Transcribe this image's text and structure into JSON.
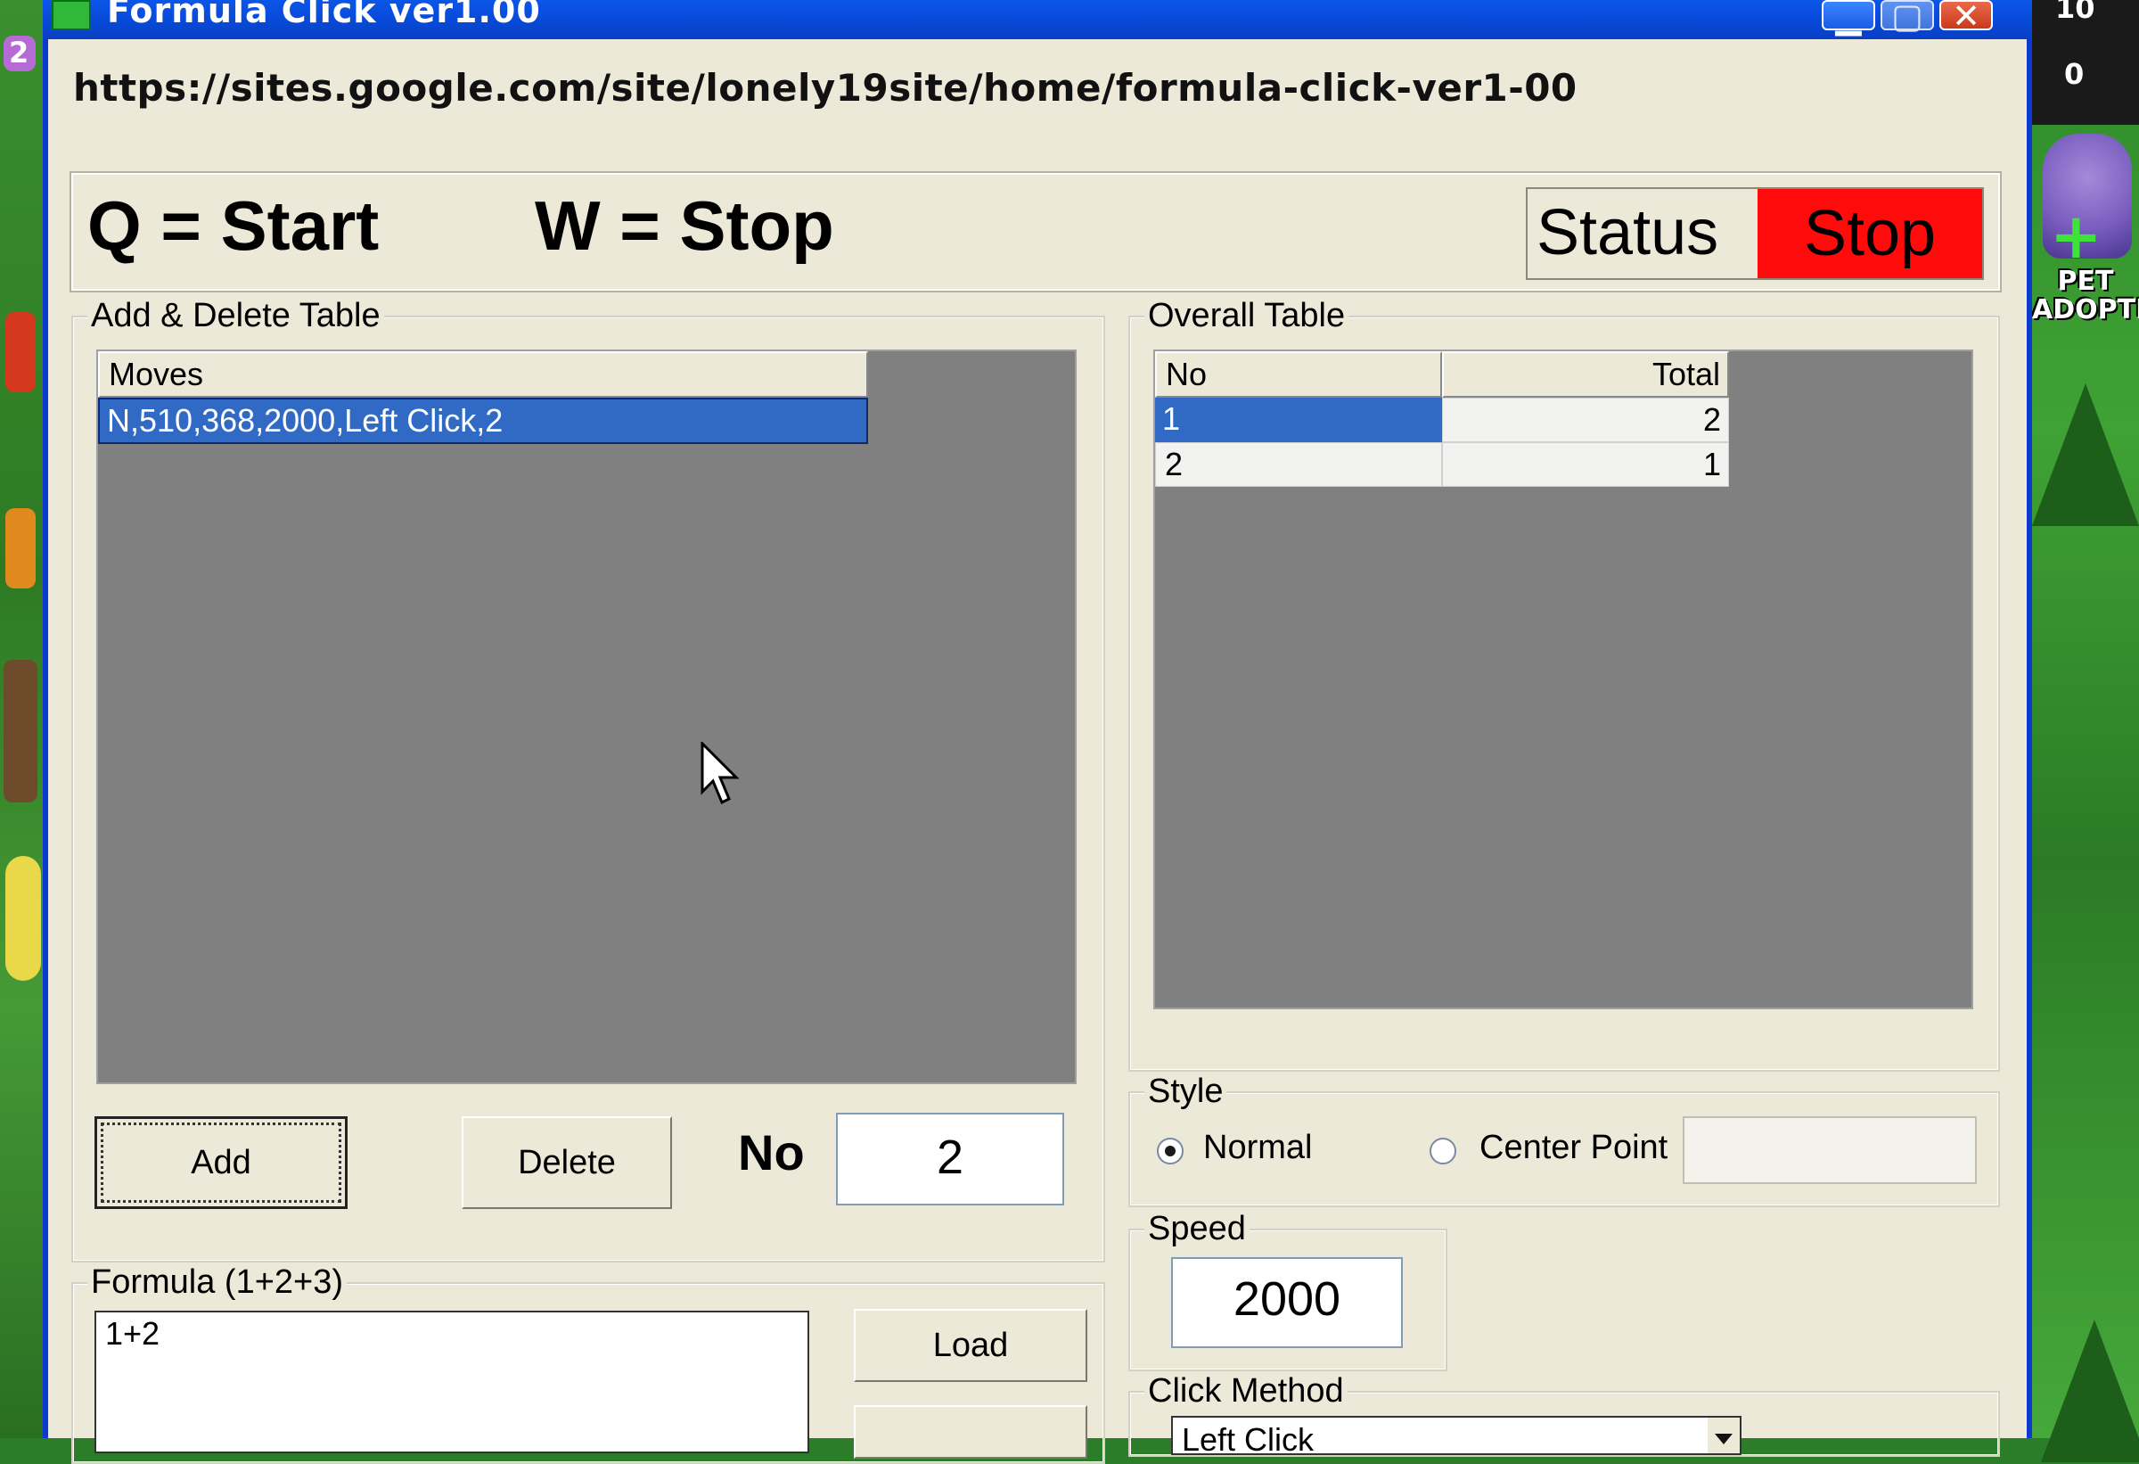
{
  "window": {
    "title": "Formula Click ver1.00",
    "min_glyph": "▁",
    "max_glyph": "▢",
    "close_glyph": "✕"
  },
  "url": "https://sites.google.com/site/lonely19site/home/formula-click-ver1-00",
  "hotkeys": {
    "start": "Q = Start",
    "stop": "W = Stop"
  },
  "status": {
    "label": "Status",
    "value": "Stop",
    "value_color": "#ff0b0b"
  },
  "add_delete": {
    "title": "Add & Delete Table",
    "column": "Moves",
    "rows": [
      "N,510,368,2000,Left Click,2"
    ],
    "add_label": "Add",
    "delete_label": "Delete",
    "no_label": "No",
    "no_value": "2"
  },
  "overall": {
    "title": "Overall Table",
    "columns": [
      "No",
      "Total"
    ],
    "rows": [
      {
        "no": "1",
        "total": "2"
      },
      {
        "no": "2",
        "total": "1"
      }
    ]
  },
  "style": {
    "title": "Style",
    "normal_label": "Normal",
    "center_label": "Center Point",
    "selected": "Normal",
    "center_value": ""
  },
  "speed": {
    "title": "Speed",
    "value": "2000"
  },
  "formula": {
    "title": "Formula (1+2+3)",
    "value": "1+2",
    "load_label": "Load"
  },
  "click_method": {
    "title": "Click Method",
    "selected": "Left Click"
  },
  "game_hud": {
    "top_value": "10",
    "second_value": "0",
    "left_badge": "2",
    "pet_label": "PET ADOPTION"
  }
}
